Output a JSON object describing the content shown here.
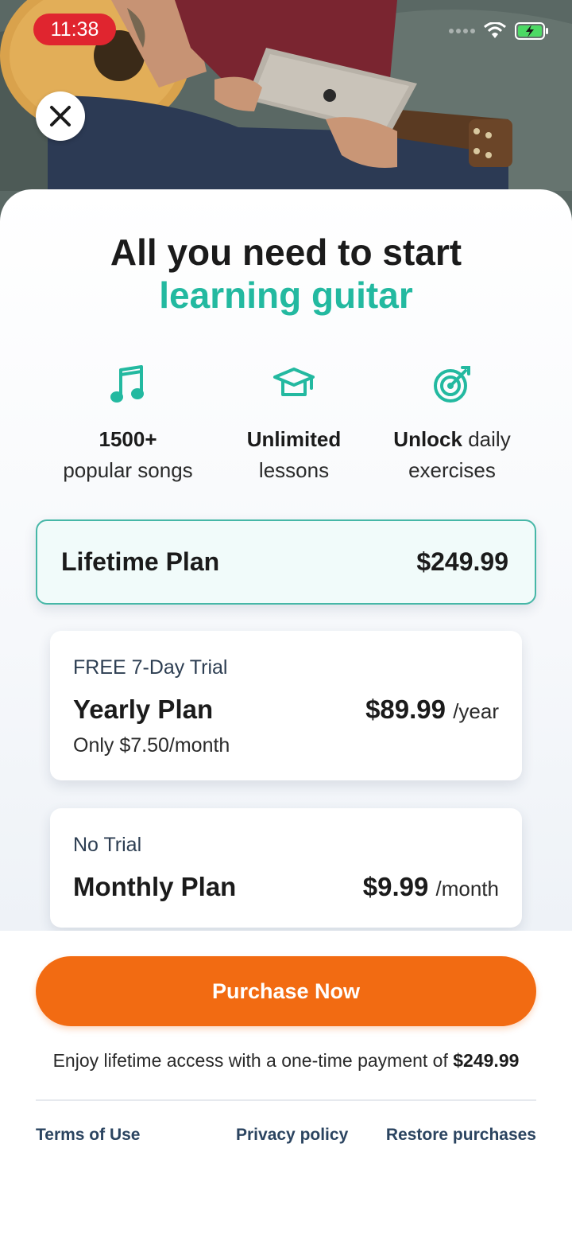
{
  "status_bar": {
    "time": "11:38"
  },
  "hero": {
    "close_icon": "close-icon"
  },
  "headline": {
    "line1": "All you need to start",
    "line2": "learning guitar"
  },
  "features": [
    {
      "icon": "music-note-icon",
      "bold": "1500+",
      "rest": "popular songs"
    },
    {
      "icon": "graduation-cap-icon",
      "bold": "Unlimited",
      "rest": "lessons"
    },
    {
      "icon": "target-icon",
      "bold": "Unlock",
      "rest_inline": "daily",
      "rest": "exercises"
    }
  ],
  "plans": {
    "lifetime": {
      "name": "Lifetime Plan",
      "price": "$249.99",
      "selected": true
    },
    "yearly": {
      "tag": "FREE 7-Day Trial",
      "name": "Yearly Plan",
      "price": "$89.99",
      "period": "/year",
      "sub": "Only $7.50/month"
    },
    "monthly": {
      "tag": "No Trial",
      "name": "Monthly Plan",
      "price": "$9.99",
      "period": "/month"
    }
  },
  "cta": {
    "label": "Purchase Now"
  },
  "note": {
    "text": "Enjoy lifetime access with a one-time payment of",
    "amount": "$249.99"
  },
  "footer": {
    "terms": "Terms of Use",
    "privacy": "Privacy policy",
    "restore": "Restore purchases"
  },
  "colors": {
    "accent": "#23b9a0",
    "cta": "#f26b12",
    "status_pill": "#e0252f"
  }
}
